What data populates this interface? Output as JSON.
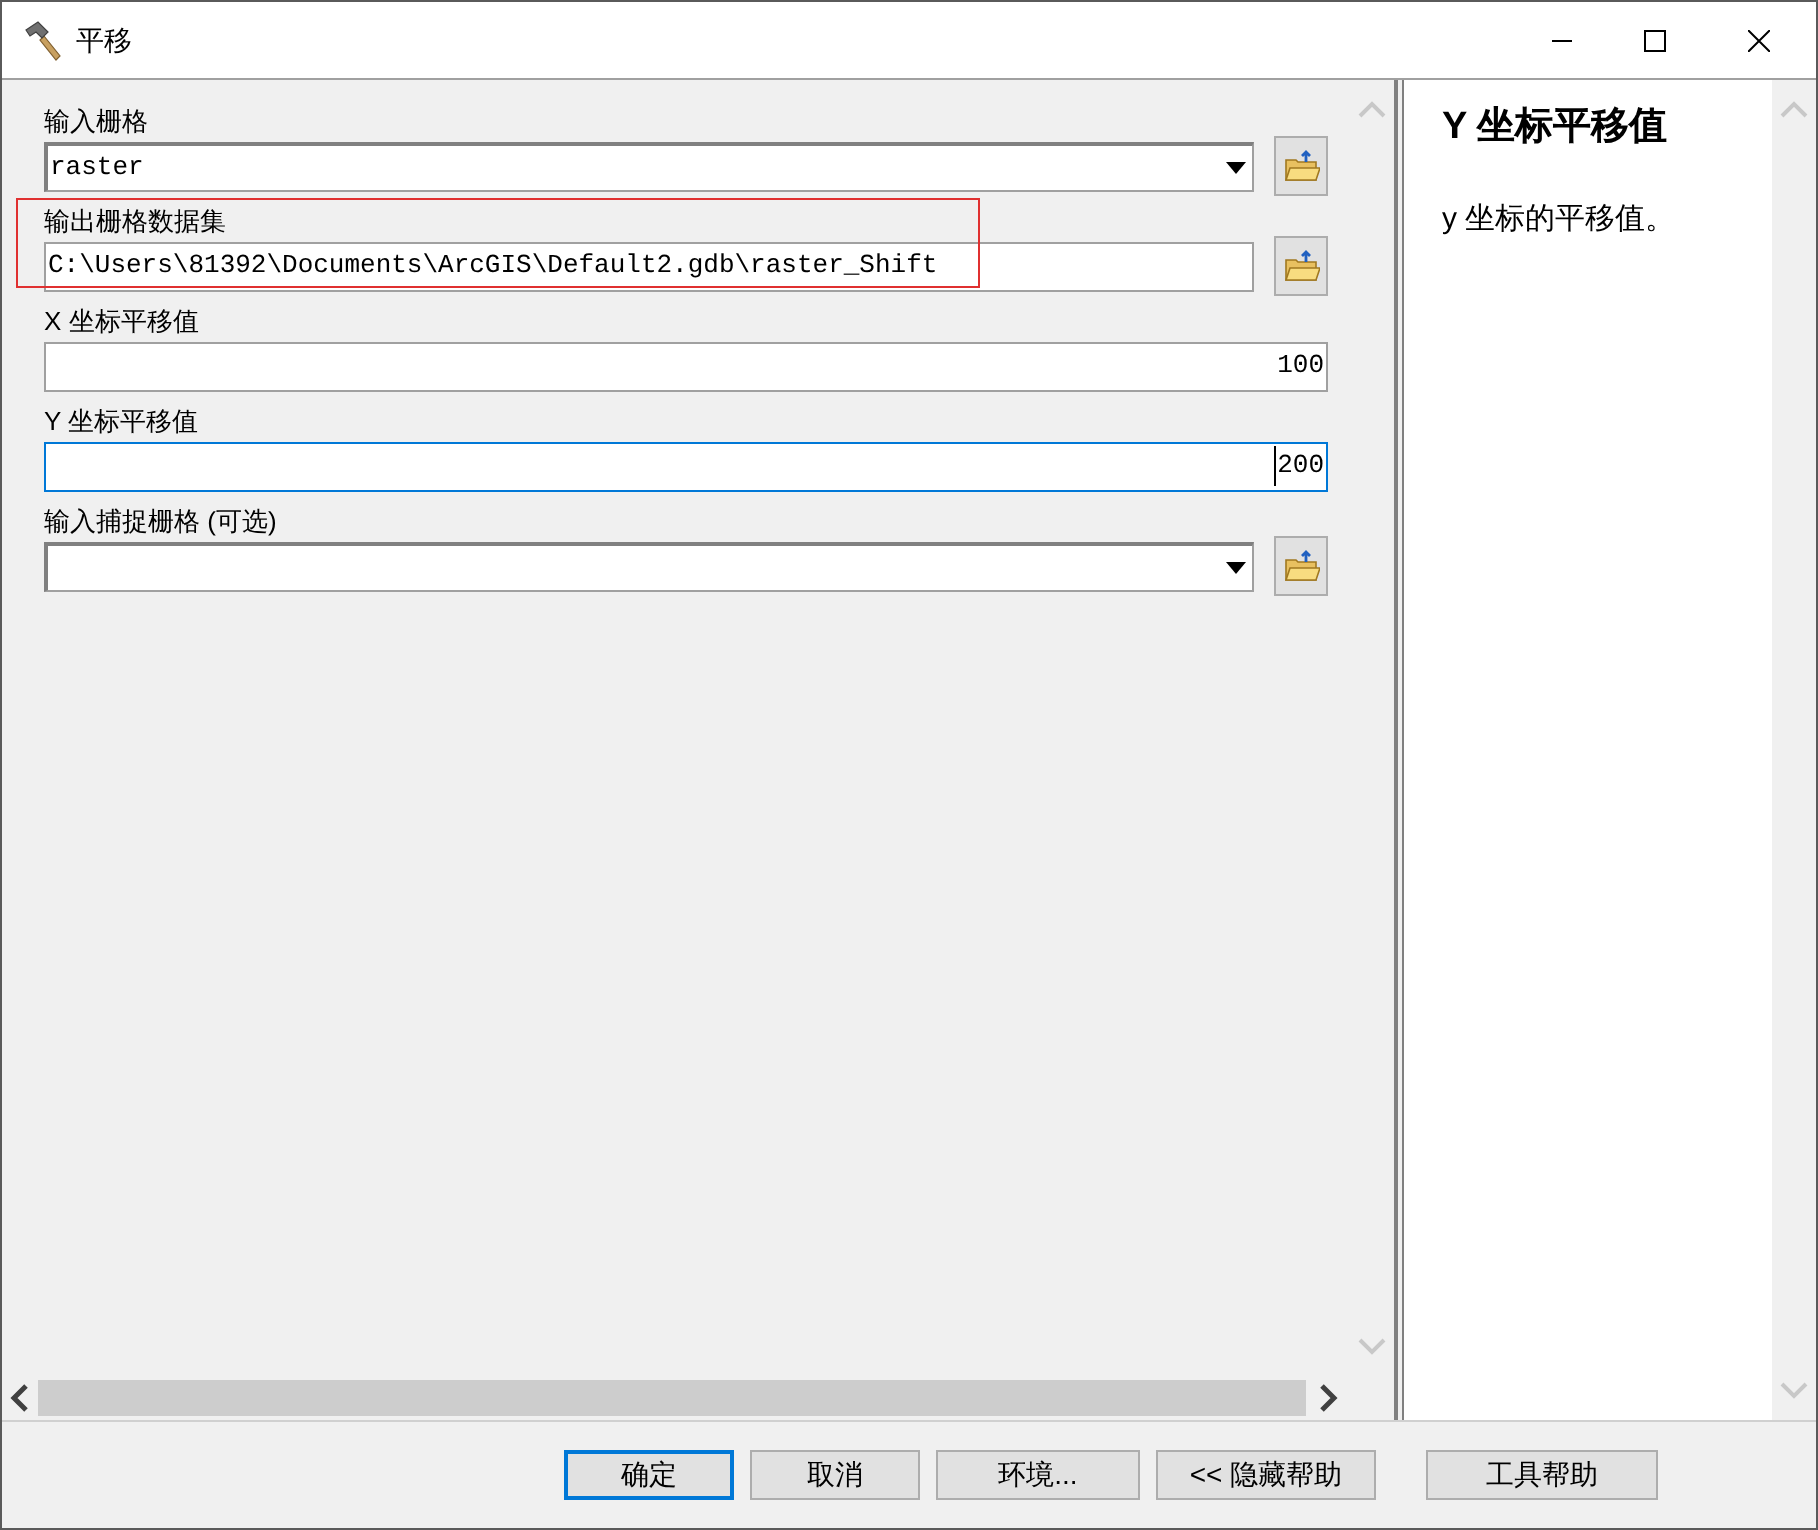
{
  "window": {
    "title": "平移"
  },
  "parameters": [
    {
      "label": "输入栅格",
      "kind": "dropdown",
      "value": "raster",
      "focused": false,
      "highlighted": false
    },
    {
      "label": "输出栅格数据集",
      "kind": "path",
      "value": "C:\\Users\\81392\\Documents\\ArcGIS\\Default2.gdb\\raster_Shift",
      "focused": false,
      "highlighted": true
    },
    {
      "label": "X 坐标平移值",
      "kind": "number",
      "value": "100",
      "focused": false,
      "highlighted": false
    },
    {
      "label": "Y 坐标平移值",
      "kind": "number",
      "value": "200",
      "focused": true,
      "highlighted": false
    },
    {
      "label": "输入捕捉栅格 (可选)",
      "kind": "dropdown",
      "focused": false,
      "highlighted": false
    }
  ],
  "help": {
    "title": "Y 坐标平移值",
    "text": "y 坐标的平移值。"
  },
  "buttons": [
    {
      "label": "确定",
      "default": true
    },
    {
      "label": "取消",
      "default": false
    },
    {
      "label": "环境...",
      "default": false
    },
    {
      "label": "<< 隐藏帮助",
      "default": false
    },
    {
      "label": "工具帮助",
      "default": false
    }
  ]
}
